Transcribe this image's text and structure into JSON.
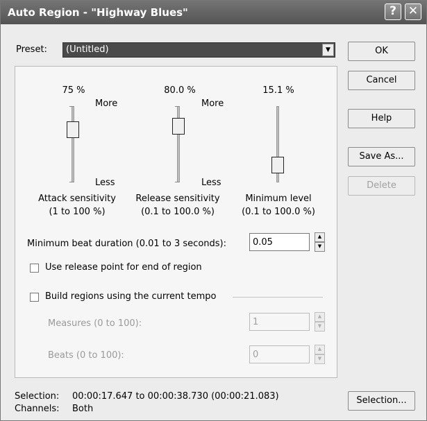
{
  "window": {
    "title": "Auto Region - \"Highway Blues\""
  },
  "titlebar": {
    "help": "?",
    "close": "✕"
  },
  "preset": {
    "label": "Preset:",
    "value": "(Untitled)"
  },
  "buttons": {
    "ok": "OK",
    "cancel": "Cancel",
    "help": "Help",
    "save_as": "Save As...",
    "delete": "Delete",
    "selection": "Selection..."
  },
  "sliders": {
    "attack": {
      "value_text": "75 %",
      "more": "More",
      "less": "Less",
      "label": "Attack sensitivity",
      "range": "(1 to 100 %)",
      "level": 0.75
    },
    "release": {
      "value_text": "80.0 %",
      "more": "More",
      "less": "Less",
      "label": "Release sensitivity",
      "range": "(0.1 to 100.0 %)",
      "level": 0.8
    },
    "minlevel": {
      "value_text": "15.1 %",
      "label": "Minimum level",
      "range": "(0.1 to 100.0 %)",
      "level": 0.151
    }
  },
  "min_beat": {
    "label": "Minimum beat duration (0.01 to 3 seconds):",
    "value": "0.05"
  },
  "release_point": {
    "label": "Use release point for end of region",
    "checked": false
  },
  "tempo": {
    "label": "Build regions using the current tempo",
    "checked": false
  },
  "measures": {
    "label": "Measures (0 to 100):",
    "value": "1"
  },
  "beats": {
    "label": "Beats (0 to 100):",
    "value": "0"
  },
  "status": {
    "selection_label": "Selection:",
    "selection_value": "00:00:17.647 to 00:00:38.730 (00:00:21.083)",
    "channels_label": "Channels:",
    "channels_value": "Both"
  },
  "colors": {
    "titlebar": "#606060",
    "combo": "#4a4a4a",
    "dialog_bg": "#ececec"
  }
}
